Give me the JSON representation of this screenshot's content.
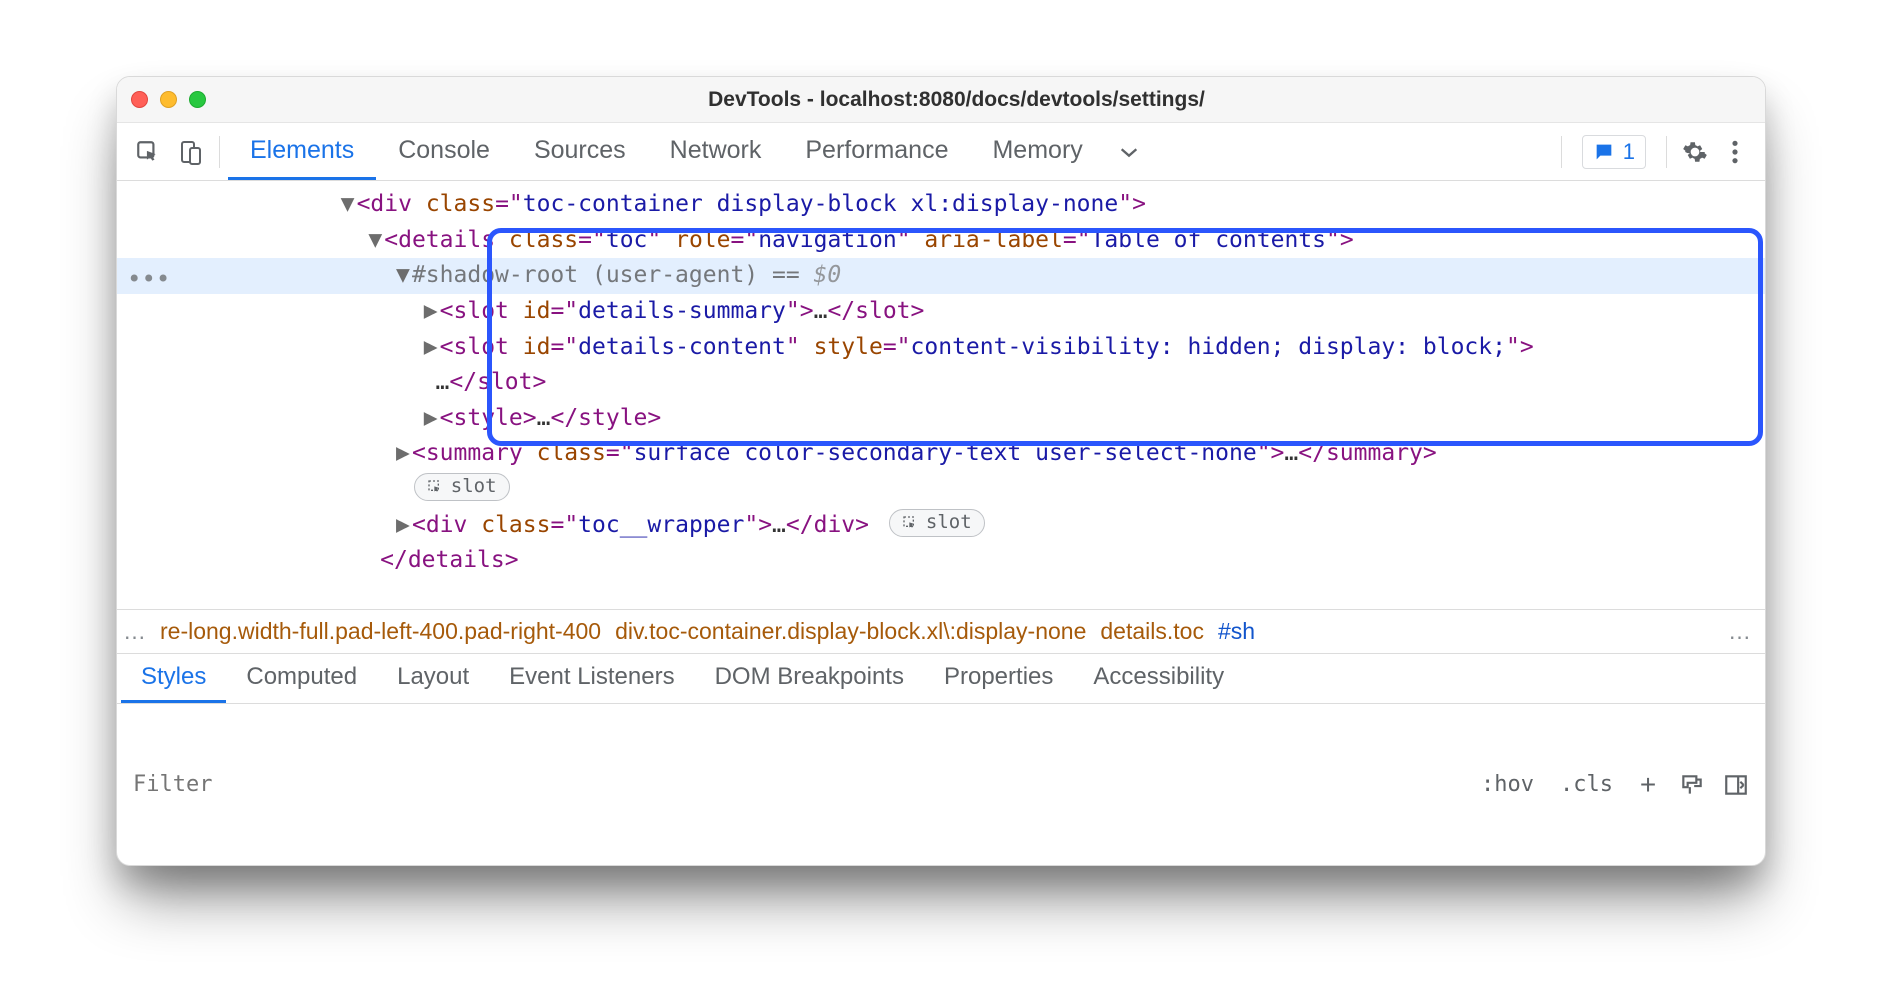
{
  "window": {
    "title": "DevTools - localhost:8080/docs/devtools/settings/"
  },
  "toolbar": {
    "tabs": [
      "Elements",
      "Console",
      "Sources",
      "Network",
      "Performance",
      "Memory"
    ],
    "active_tab": 0,
    "issues_count": "1"
  },
  "dom": {
    "lines": {
      "l0_toggle": "▼",
      "l0_open": "<",
      "l0_tag": "div",
      "l0_sp": " ",
      "l0_an": "class",
      "l0_eq": "=\"",
      "l0_av": "toc-container display-block xl:display-none",
      "l0_cl": "\">",
      "l1_toggle": "▼",
      "l1_open": "<",
      "l1_tag": "details",
      "l1_sp": " ",
      "l1_an1": "class",
      "l1_eq1": "=\"",
      "l1_av1": "toc",
      "l1_q1": "\" ",
      "l1_an2": "role",
      "l1_eq2": "=\"",
      "l1_av2": "navigation",
      "l1_q2": "\" ",
      "l1_an3": "aria-label",
      "l1_eq3": "=\"",
      "l1_av3": "Table of contents",
      "l1_q3": "\">",
      "gutter_dots": "•••",
      "l2_toggle": "▼",
      "l2_text": "#shadow-root (user-agent)",
      "l2_eqeq": " == ",
      "l2_zero": "$0",
      "l3_toggle": "▶",
      "l3_open": "<",
      "l3_tag": "slot",
      "l3_sp": " ",
      "l3_an": "id",
      "l3_eq": "=\"",
      "l3_av": "details-summary",
      "l3_cl": "\">",
      "l3_ell": "…",
      "l3_close": "</",
      "l3_ctag": "slot",
      "l3_gt": ">",
      "l4_toggle": "▶",
      "l4_open": "<",
      "l4_tag": "slot",
      "l4_sp": " ",
      "l4_an1": "id",
      "l4_eq1": "=\"",
      "l4_av1": "details-content",
      "l4_q1": "\" ",
      "l4_an2": "style",
      "l4_eq2": "=\"",
      "l4_av2": "content-visibility: hidden; display: block;",
      "l4_q2": "\">",
      "l4b_ell": "…",
      "l4b_close": "</",
      "l4b_ctag": "slot",
      "l4b_gt": ">",
      "l5_toggle": "▶",
      "l5_open": "<",
      "l5_tag": "style",
      "l5_gt": ">",
      "l5_ell": "…",
      "l5_close": "</",
      "l5_ctag": "style",
      "l5_cgt": ">",
      "l6_toggle": "▶",
      "l6_open": "<",
      "l6_tag": "summary",
      "l6_sp": " ",
      "l6_an": "class",
      "l6_eq": "=\"",
      "l6_av": "surface color-secondary-text user-select-none",
      "l6_cl": "\">",
      "l6_ell": "…",
      "l6_close": "</",
      "l6_ctag": "summary",
      "l6_cgt": ">",
      "l6_pill": "slot",
      "l7_toggle": "▶",
      "l7_open": "<",
      "l7_tag": "div",
      "l7_sp": " ",
      "l7_an": "class",
      "l7_eq": "=\"",
      "l7_av": "toc__wrapper",
      "l7_cl": "\">",
      "l7_ell": "…",
      "l7_close": "</",
      "l7_ctag": "div",
      "l7_cgt": ">",
      "l7_pill": "slot",
      "l8_close": "</",
      "l8_ctag": "details",
      "l8_gt": ">"
    }
  },
  "crumbs": {
    "left_ell": "…",
    "c1": "re-long.width-full.pad-left-400.pad-right-400",
    "c2": "div.toc-container.display-block.xl\\:display-none",
    "c3": "details.toc",
    "c4": "#sh",
    "right_ell": "…"
  },
  "subtabs": {
    "items": [
      "Styles",
      "Computed",
      "Layout",
      "Event Listeners",
      "DOM Breakpoints",
      "Properties",
      "Accessibility"
    ],
    "active": 0
  },
  "filter": {
    "placeholder": "Filter",
    "hov": ":hov",
    "cls": ".cls",
    "plus": "+"
  }
}
